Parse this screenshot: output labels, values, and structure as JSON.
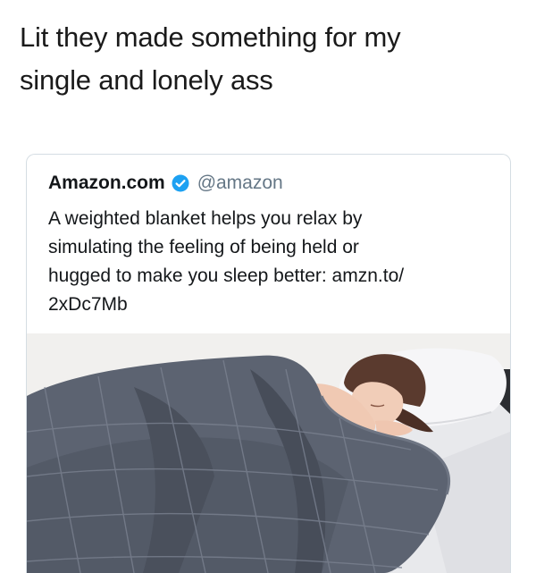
{
  "caption": {
    "lines": [
      "Lit they made something for my",
      "single and lonely ass"
    ]
  },
  "tweet": {
    "display_name": "Amazon.com",
    "verified_icon": "verified-check-icon",
    "handle": "@amazon",
    "text_lines": [
      "A weighted blanket helps you relax by",
      "simulating the feeling of being held or",
      "hugged to make you sleep better: amzn.to/",
      "2xDc7Mb"
    ],
    "image": {
      "subject": "woman-sleeping-under-weighted-blanket",
      "colors": {
        "blanket": "#5b6270",
        "blanket_shadow": "#3f4550",
        "pillow": "#f4f4f6",
        "hair": "#5a3a2e",
        "skin": "#f1cdb8",
        "wall": "#f2f1ef"
      }
    },
    "accent_color": "#1da1f2"
  }
}
